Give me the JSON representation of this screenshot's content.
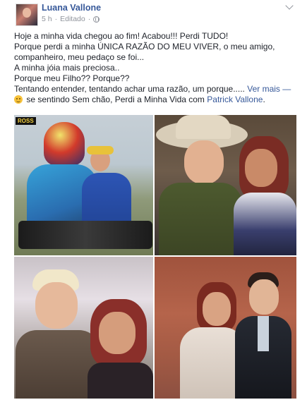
{
  "post": {
    "author": "Luana Vallone",
    "time": "5 h",
    "separator": "·",
    "edited": "Editado",
    "text_lines": [
      "Hoje a minha vida chegou ao fim! Acabou!!! Perdi TUDO!",
      "Porque perdi a minha ÚNICA RAZÃO DO MEU VIVER, o meu amigo,",
      "companheiro, meu pedaço se foi...",
      "A minha jóia mais preciosa..",
      "Porque meu Filho?? Porque??"
    ],
    "last_line_text": "Tentando entender, tentando achar uma razão, um porque.....",
    "see_more": "Ver mais",
    "dash": "—",
    "feeling_text": "se sentindo Sem chão, Perdi a Minha Vida com",
    "tagged_person": "Patrick Vallone",
    "period": "."
  },
  "photos": {
    "photo1_badge": "ROSS"
  },
  "colors": {
    "link": "#365899",
    "meta": "#90949c",
    "text": "#1d2129"
  },
  "icons": [
    "globe-icon",
    "chevron-down-icon",
    "emoji-icon"
  ]
}
